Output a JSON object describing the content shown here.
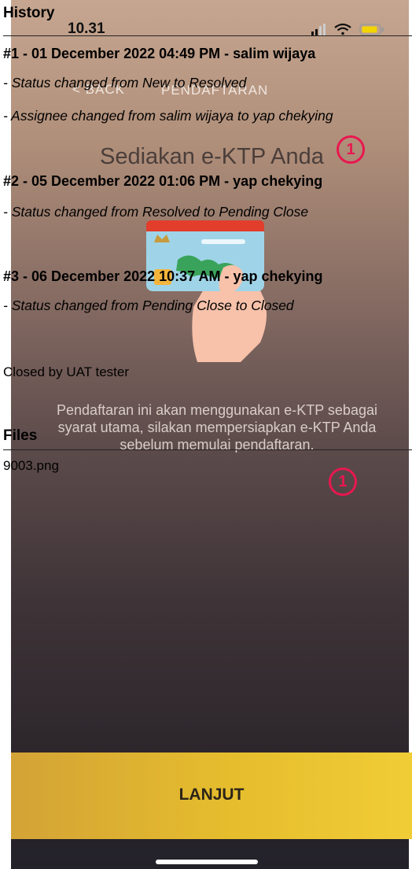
{
  "phone": {
    "status_time": "10.31",
    "nav_back": "< BACK",
    "nav_title": "PENDAFTARAN",
    "title": "Sediakan e-KTP Anda",
    "badge": "1",
    "instruction": "Pendaftaran ini akan menggunakan e-KTP sebagai syarat utama, silakan mempersiapkan e-KTP Anda sebelum memulai pendaftaran.",
    "cta_label": "LANJUT",
    "colors": {
      "accent": "#e8174f",
      "button": "#e6bd2d"
    }
  },
  "history": {
    "heading": "History",
    "entries": [
      {
        "header": "#1 - 01 December 2022 04:49 PM - salim wijaya",
        "changes": [
          "Status changed from New to Resolved",
          "Assignee changed from salim wijaya to yap chekying"
        ]
      },
      {
        "header": "#2 - 05 December 2022 01:06 PM - yap chekying",
        "changes": [
          "Status changed from Resolved to Pending Close"
        ]
      },
      {
        "header": "#3 - 06 December 2022 10:37 AM - yap chekying",
        "changes": [
          "Status changed from Pending Close to Closed"
        ],
        "note": "Closed by UAT tester"
      }
    ]
  },
  "files": {
    "heading": "Files",
    "items": [
      "9003.png"
    ]
  }
}
